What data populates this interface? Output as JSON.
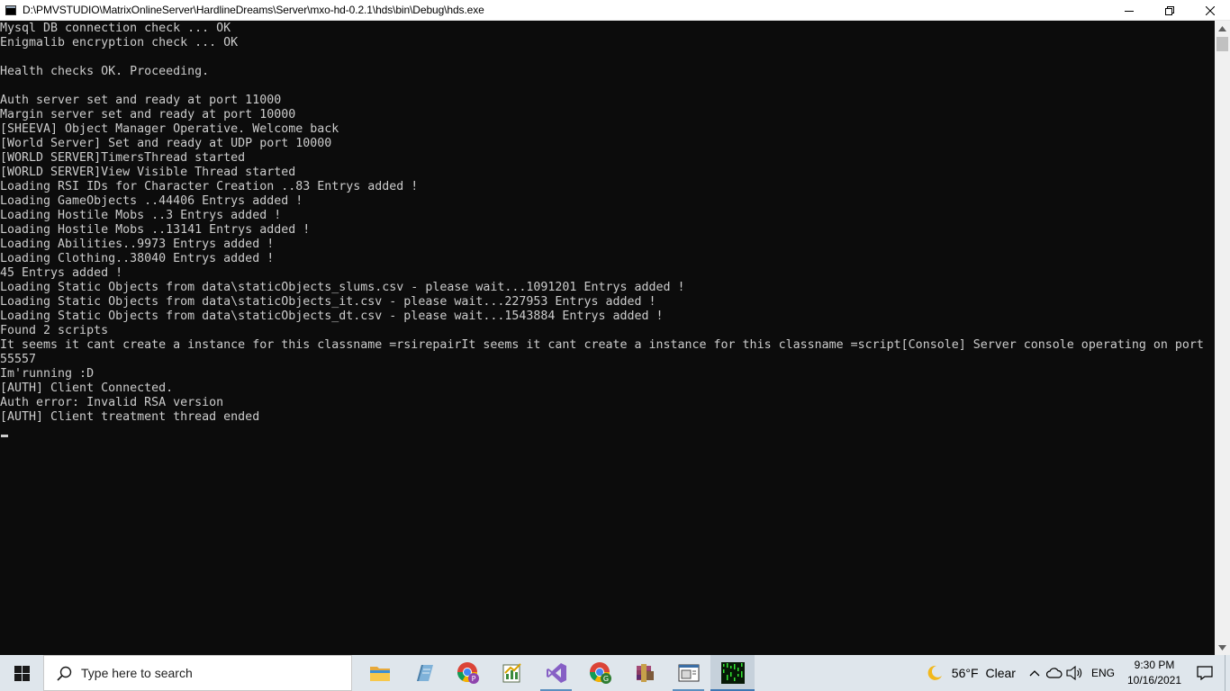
{
  "window": {
    "title": "D:\\PMVSTUDIO\\MatrixOnlineServer\\HardlineDreams\\Server\\mxo-hd-0.2.1\\hds\\bin\\Debug\\hds.exe",
    "controls": [
      "minimize-icon",
      "restore-icon",
      "close-icon"
    ]
  },
  "console": {
    "lines": [
      "Mysql DB connection check ... OK",
      "Enigmalib encryption check ... OK",
      "",
      "Health checks OK. Proceeding.",
      "",
      "Auth server set and ready at port 11000",
      "Margin server set and ready at port 10000",
      "[SHEEVA] Object Manager Operative. Welcome back",
      "[World Server] Set and ready at UDP port 10000",
      "[WORLD SERVER]TimersThread started",
      "[WORLD SERVER]View Visible Thread started",
      "Loading RSI IDs for Character Creation ..83 Entrys added !",
      "Loading GameObjects ..44406 Entrys added !",
      "Loading Hostile Mobs ..3 Entrys added !",
      "Loading Hostile Mobs ..13141 Entrys added !",
      "Loading Abilities..9973 Entrys added !",
      "Loading Clothing..38040 Entrys added !",
      "45 Entrys added !",
      "Loading Static Objects from data\\staticObjects_slums.csv - please wait...1091201 Entrys added !",
      "Loading Static Objects from data\\staticObjects_it.csv - please wait...227953 Entrys added !",
      "Loading Static Objects from data\\staticObjects_dt.csv - please wait...1543884 Entrys added !",
      "Found 2 scripts",
      "It seems it cant create a instance for this classname =rsirepairIt seems it cant create a instance for this classname =script[Console] Server console operating on port",
      "55557",
      "Im'running :D",
      "[AUTH] Client Connected.",
      "Auth error: Invalid RSA version",
      "[AUTH] Client treatment thread ended"
    ],
    "colors": {
      "background": "#0c0c0c",
      "text": "#cccccc"
    }
  },
  "taskbar": {
    "search_placeholder": "Type here to search",
    "apps": [
      {
        "icon": "file-explorer-icon",
        "state": "normal"
      },
      {
        "icon": "notepad-icon",
        "state": "normal"
      },
      {
        "icon": "chrome-profile-p-icon",
        "state": "normal"
      },
      {
        "icon": "chart-app-icon",
        "state": "normal"
      },
      {
        "icon": "visual-studio-icon",
        "state": "running"
      },
      {
        "icon": "chrome-profile-g-icon",
        "state": "normal"
      },
      {
        "icon": "winrar-icon",
        "state": "normal"
      },
      {
        "icon": "console-window-icon",
        "state": "running"
      },
      {
        "icon": "matrix-app-icon",
        "state": "active"
      }
    ],
    "weather": {
      "temp": "56°F",
      "condition": "Clear",
      "icon": "moon-icon"
    },
    "language": "ENG",
    "time": "9:30 PM",
    "date": "10/16/2021"
  }
}
